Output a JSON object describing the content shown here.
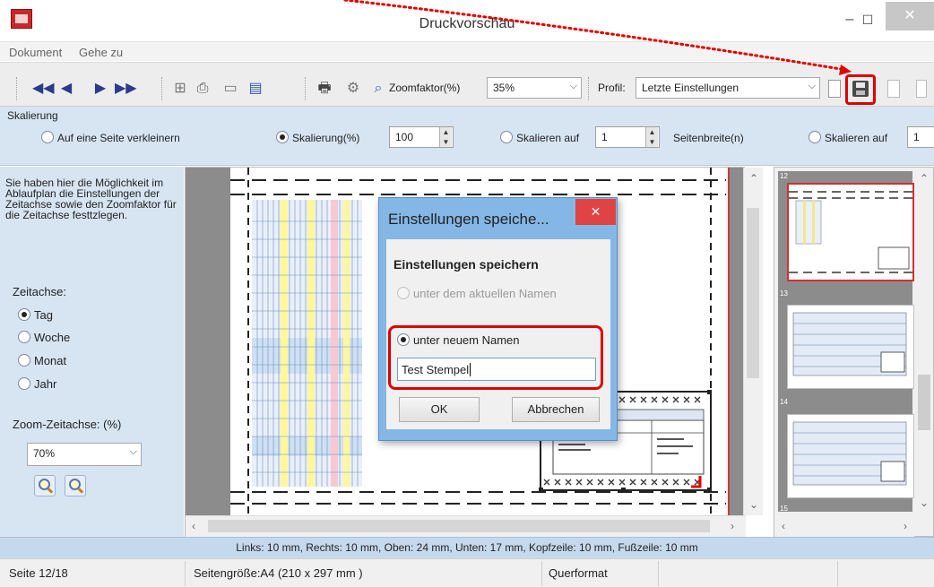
{
  "window": {
    "title": "Druckvorschau",
    "minimize": "–",
    "maximize": "☐",
    "close": "✕"
  },
  "menu": {
    "items": [
      "Dokument",
      "Gehe zu"
    ]
  },
  "toolbar": {
    "zoom_label": "Zoomfaktor(%)",
    "zoom_value": "35%",
    "profile_label": "Profil:",
    "profile_value": "Letzte Einstellungen"
  },
  "scaling": {
    "title": "Skalierung",
    "opt_fit_page": "Auf eine Seite verkleinern",
    "opt_scale_pct": "Skalierung(%)",
    "scale_value": "100",
    "opt_scale_to": "Skalieren auf",
    "scale_to_value": "1",
    "page_width_label": "Seitenbreite(n)",
    "opt_scale_to2": "Skalieren auf",
    "scale_to2_value": "1",
    "selected": "opt_scale_pct"
  },
  "side": {
    "description": "Sie haben hier die Möglichkeit im Ablaufplan die Einstellungen der Zeitachse sowie den Zoomfaktor für die Zeitachse festtzlegen.",
    "timeline_label": "Zeitachse:",
    "options": [
      "Tag",
      "Woche",
      "Monat",
      "Jahr"
    ],
    "selected": "Tag",
    "zoom_label": "Zoom-Zeitachse: (%)",
    "zoom_value": "70%"
  },
  "thumbnails": [
    "12",
    "13",
    "14",
    "15"
  ],
  "dialog": {
    "title": "Einstellungen speiche...",
    "close": "✕",
    "heading": "Einstellungen speichern",
    "opt_current": "unter dem aktuellen Namen",
    "opt_new": "unter neuem Namen",
    "name_value": "Test Stempel",
    "ok": "OK",
    "cancel": "Abbrechen"
  },
  "margins": "Links: 10 mm, Rechts: 10 mm, Oben: 24 mm, Unten: 17 mm, Kopfzeile: 10 mm, Fußzeile: 10 mm",
  "status": {
    "page": "Seite 12/18",
    "page_size": "Seitengröße:A4 (210 x 297 mm )",
    "orientation": "Querformat"
  },
  "colors": {
    "highlight_red": "#e00000",
    "panel_blue": "#d7e4f2",
    "dialog_frame": "#84b7e6"
  }
}
